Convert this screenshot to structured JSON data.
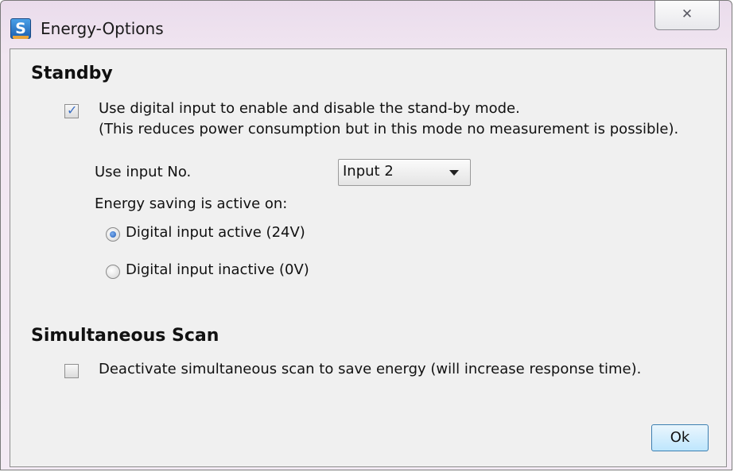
{
  "window": {
    "title": "Energy-Options",
    "app_icon_letter": "S",
    "close_symbol": "✕"
  },
  "standby": {
    "heading": "Standby",
    "checkbox_checked": true,
    "checkbox_line1": "Use digital input to enable and disable the stand-by mode.",
    "checkbox_line2": "(This reduces power consumption but in this mode no measurement is possible).",
    "input_label": "Use input No.",
    "input_selected": "Input 2",
    "saving_label": "Energy saving is active on:",
    "radio_active_label": "Digital input active (24V)",
    "radio_inactive_label": "Digital input inactive (0V)",
    "selected_radio": "active"
  },
  "scan": {
    "heading": "Simultaneous Scan",
    "checkbox_checked": false,
    "checkbox_label": "Deactivate simultaneous scan to save energy (will increase response time)."
  },
  "footer": {
    "ok_label": "Ok"
  },
  "colors": {
    "accent": "#3a6ec4",
    "title_gradient": "#eadcec",
    "client_bg": "#f0f0f0"
  }
}
